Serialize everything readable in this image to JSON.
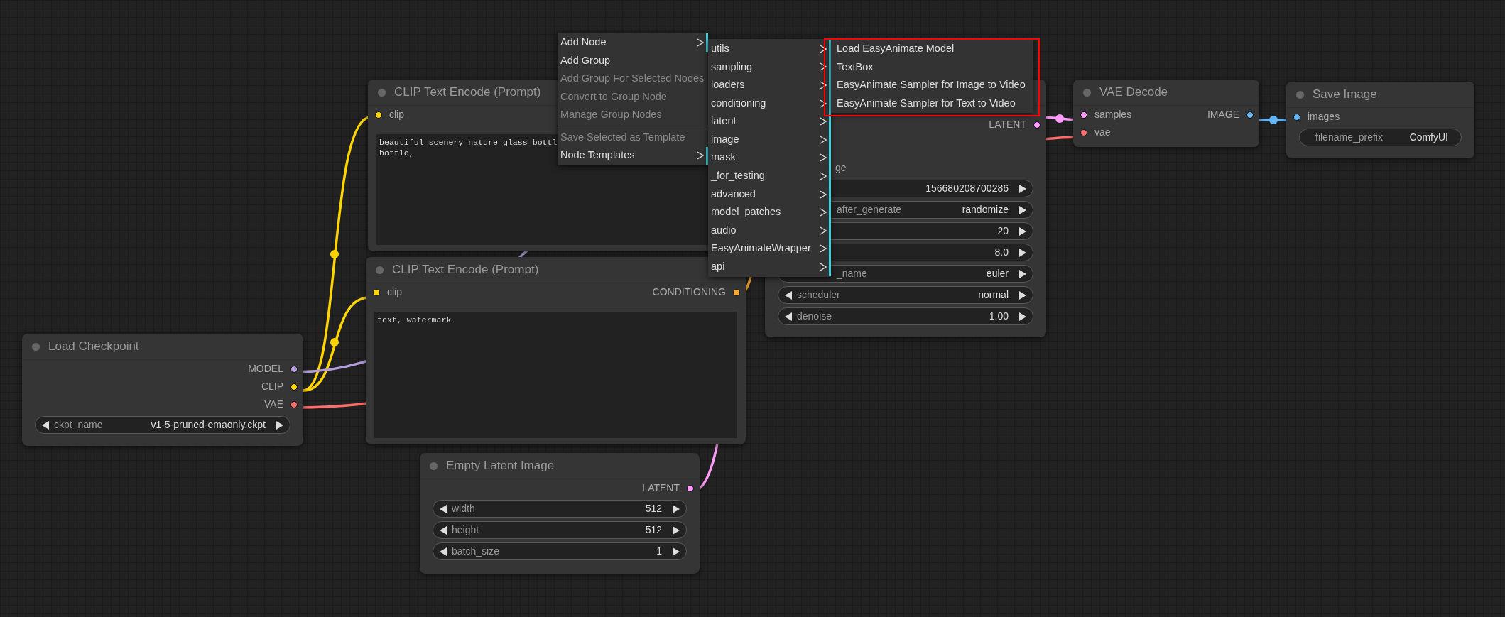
{
  "nodes": [
    {
      "kind": "prompt",
      "title": "CLIP Text Encode (Prompt)",
      "inputs": [
        {
          "label": "clip",
          "color": "#ffd500"
        }
      ],
      "text": "beautiful scenery nature glass bottl\nbottle,"
    },
    {
      "kind": "prompt",
      "title": "CLIP Text Encode (Prompt)",
      "inputs": [
        {
          "label": "clip",
          "color": "#ffd500"
        }
      ],
      "outputs": [
        {
          "label": "CONDITIONING",
          "color": "#ffa931"
        }
      ],
      "text": "text, watermark"
    },
    {
      "kind": "widgets",
      "title": "Load Checkpoint",
      "outputs": [
        {
          "label": "MODEL",
          "color": "#b39ddb"
        },
        {
          "label": "CLIP",
          "color": "#ffd500"
        },
        {
          "label": "VAE",
          "color": "#ff6e6e"
        }
      ],
      "widgets": [
        {
          "kind": "combo",
          "label": "ckpt_name",
          "value": "v1-5-pruned-emaonly.ckpt",
          "cut": false
        }
      ]
    },
    {
      "kind": "widgets",
      "title": "Empty Latent Image",
      "outputs": [
        {
          "label": "LATENT",
          "color": "#ff9cf9"
        }
      ],
      "widgets": [
        {
          "kind": "number",
          "label": "width",
          "value": "512",
          "cut": false
        },
        {
          "kind": "number",
          "label": "height",
          "value": "512",
          "cut": false
        },
        {
          "kind": "number",
          "label": "batch_size",
          "value": "1",
          "cut": false
        }
      ]
    },
    {
      "kind": "widgets",
      "inputs": [
        {
          "label": "ge"
        }
      ],
      "outputs": [
        {
          "label": "LATENT",
          "color": "#ff9cf9"
        }
      ],
      "widgets": [
        {
          "kind": "number",
          "value": "156680208700286"
        },
        {
          "kind": "combo",
          "label": "after_generate",
          "value": "randomize",
          "cut": true
        },
        {
          "kind": "number",
          "value": "20"
        },
        {
          "kind": "number",
          "value": "8.0"
        },
        {
          "kind": "combo",
          "label": "_name",
          "value": "euler",
          "cut": true
        },
        {
          "kind": "combo",
          "label": "scheduler",
          "value": "normal",
          "cut": false
        },
        {
          "kind": "number",
          "label": "denoise",
          "value": "1.00",
          "cut": false
        }
      ]
    },
    {
      "kind": "widgets",
      "title": "VAE Decode",
      "inputs": [
        {
          "label": "samples",
          "color": "#ff9cf9"
        },
        {
          "label": "vae",
          "color": "#ff6e6e"
        }
      ],
      "outputs": [
        {
          "label": "IMAGE",
          "color": "#64b5f6"
        }
      ]
    },
    {
      "kind": "widgets",
      "title": "Save Image",
      "inputs": [
        {
          "label": "images",
          "color": "#64b5f6"
        }
      ],
      "widgets": [
        {
          "kind": "text",
          "label": "filename_prefix",
          "value": "ComfyUI",
          "cut": false
        }
      ]
    }
  ],
  "context_menu": {
    "items": [
      {
        "kind": "entry",
        "label": "Add Node",
        "disabled": false,
        "submenu": true
      },
      {
        "kind": "entry",
        "label": "Add Group",
        "disabled": false,
        "submenu": false
      },
      {
        "kind": "entry",
        "label": "Add Group For Selected Nodes",
        "disabled": true,
        "submenu": false
      },
      {
        "kind": "entry",
        "label": "Convert to Group Node",
        "disabled": true,
        "submenu": false
      },
      {
        "kind": "entry",
        "label": "Manage Group Nodes",
        "disabled": true,
        "submenu": false
      },
      {
        "kind": "separator"
      },
      {
        "kind": "entry",
        "label": "Save Selected as Template",
        "disabled": true,
        "submenu": false
      },
      {
        "kind": "entry",
        "label": "Node Templates",
        "disabled": false,
        "submenu": true
      }
    ]
  },
  "submenu": {
    "items": [
      {
        "kind": "entry",
        "label": "utils",
        "disabled": false,
        "submenu": true
      },
      {
        "kind": "entry",
        "label": "sampling",
        "disabled": false,
        "submenu": true
      },
      {
        "kind": "entry",
        "label": "loaders",
        "disabled": false,
        "submenu": true
      },
      {
        "kind": "entry",
        "label": "conditioning",
        "disabled": false,
        "submenu": true
      },
      {
        "kind": "entry",
        "label": "latent",
        "disabled": false,
        "submenu": true
      },
      {
        "kind": "entry",
        "label": "image",
        "disabled": false,
        "submenu": true
      },
      {
        "kind": "entry",
        "label": "mask",
        "disabled": false,
        "submenu": true
      },
      {
        "kind": "entry",
        "label": "_for_testing",
        "disabled": false,
        "submenu": true
      },
      {
        "kind": "entry",
        "label": "advanced",
        "disabled": false,
        "submenu": true
      },
      {
        "kind": "entry",
        "label": "model_patches",
        "disabled": false,
        "submenu": true
      },
      {
        "kind": "entry",
        "label": "audio",
        "disabled": false,
        "submenu": true
      },
      {
        "kind": "entry",
        "label": "EasyAnimateWrapper",
        "disabled": false,
        "submenu": true
      },
      {
        "kind": "entry",
        "label": "api",
        "disabled": false,
        "submenu": true
      }
    ]
  },
  "submenu_2": {
    "annotated": true,
    "items": [
      {
        "kind": "entry",
        "label": "Load EasyAnimate Model",
        "disabled": false,
        "submenu": false
      },
      {
        "kind": "entry",
        "label": "TextBox",
        "disabled": false,
        "submenu": false
      },
      {
        "kind": "entry",
        "label": "EasyAnimate Sampler for Image to Video",
        "disabled": false,
        "submenu": false
      },
      {
        "kind": "entry",
        "label": "EasyAnimate Sampler for Text to Video",
        "disabled": false,
        "submenu": false
      }
    ]
  }
}
